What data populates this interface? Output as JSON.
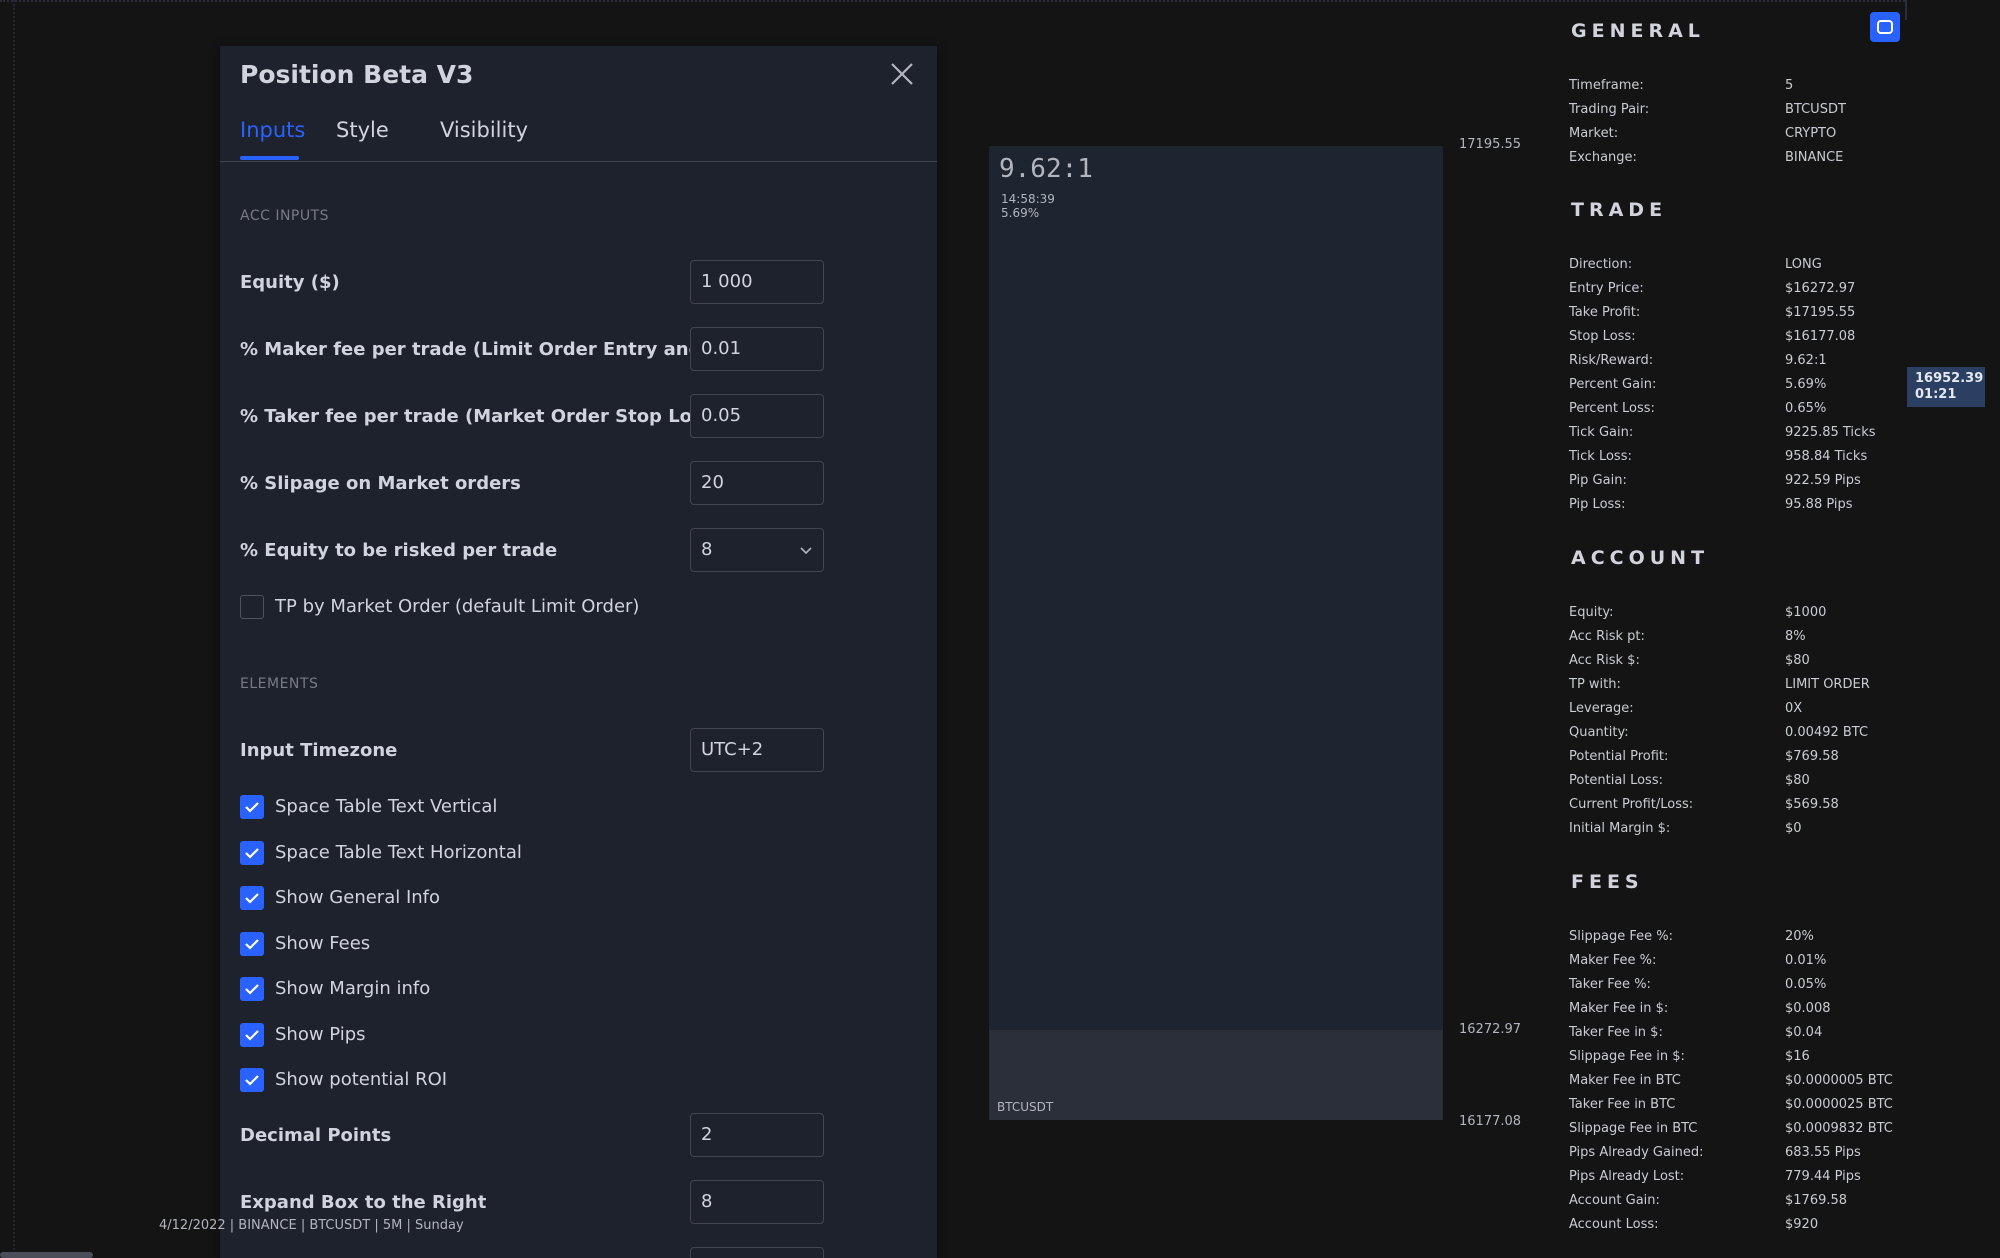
{
  "dialog": {
    "title": "Position Beta V3",
    "tabs": [
      {
        "label": "Inputs",
        "active": true
      },
      {
        "label": "Style",
        "active": false
      },
      {
        "label": "Visibility",
        "active": false
      }
    ],
    "sections": {
      "acc_inputs": "ACC INPUTS",
      "elements": "ELEMENTS"
    },
    "inputs": {
      "equity": {
        "label": "Equity ($)",
        "value": "1 000"
      },
      "maker_fee": {
        "label": "% Maker fee per trade (Limit Order Entry and Exit)",
        "value": "0.01"
      },
      "taker_fee": {
        "label": "% Taker fee per trade (Market Order Stop Loss)",
        "value": "0.05"
      },
      "slippage": {
        "label": "% Slipage on Market orders",
        "value": "20"
      },
      "risk": {
        "label": "% Equity to be risked per trade",
        "value": "8"
      },
      "tp_market": {
        "label": "TP by Market Order (default Limit Order)",
        "checked": false
      },
      "timezone": {
        "label": "Input Timezone",
        "value": "UTC+2"
      },
      "decimal_points": {
        "label": "Decimal Points",
        "value": "2"
      },
      "expand_box": {
        "label": "Expand Box to the Right",
        "value": "8"
      }
    },
    "element_checks": [
      {
        "label": "Space Table Text Vertical",
        "checked": true
      },
      {
        "label": "Space Table Text Horizontal",
        "checked": true
      },
      {
        "label": "Show General Info",
        "checked": true
      },
      {
        "label": "Show Fees",
        "checked": true
      },
      {
        "label": "Show Margin info",
        "checked": true
      },
      {
        "label": "Show Pips",
        "checked": true
      },
      {
        "label": "Show potential ROI",
        "checked": true
      }
    ]
  },
  "status_bar": "4/12/2022 | BINANCE | BTCUSDT | 5M | Sunday",
  "chart": {
    "ratio": "9.62:1",
    "time": "14:58:39",
    "percent": "5.69%",
    "symbol": "BTCUSDT",
    "prices": {
      "take_profit": "17195.55",
      "entry": "16272.97",
      "stop": "16177.08"
    },
    "price_tag": {
      "price": "16952.39",
      "countdown": "01:21"
    }
  },
  "info": {
    "general": {
      "title": "GENERAL",
      "rows": [
        {
          "k": "Timeframe:",
          "v": "5"
        },
        {
          "k": "Trading Pair:",
          "v": "BTCUSDT"
        },
        {
          "k": "Market:",
          "v": "CRYPTO"
        },
        {
          "k": "Exchange:",
          "v": "BINANCE"
        }
      ]
    },
    "trade": {
      "title": "TRADE",
      "rows": [
        {
          "k": "Direction:",
          "v": "LONG"
        },
        {
          "k": "Entry Price:",
          "v": "$16272.97"
        },
        {
          "k": "Take Profit:",
          "v": "$17195.55"
        },
        {
          "k": "Stop Loss:",
          "v": "$16177.08"
        },
        {
          "k": "Risk/Reward:",
          "v": "9.62:1"
        },
        {
          "k": "Percent Gain:",
          "v": "5.69%"
        },
        {
          "k": "Percent Loss:",
          "v": "0.65%"
        },
        {
          "k": "Tick Gain:",
          "v": "9225.85 Ticks"
        },
        {
          "k": "Tick Loss:",
          "v": "958.84 Ticks"
        },
        {
          "k": "Pip Gain:",
          "v": "922.59 Pips"
        },
        {
          "k": "Pip Loss:",
          "v": "95.88 Pips"
        }
      ]
    },
    "account": {
      "title": "ACCOUNT",
      "rows": [
        {
          "k": "Equity:",
          "v": "$1000"
        },
        {
          "k": "Acc Risk pt:",
          "v": "8%"
        },
        {
          "k": "Acc Risk $:",
          "v": "$80"
        },
        {
          "k": "TP with:",
          "v": "LIMIT ORDER"
        },
        {
          "k": "Leverage:",
          "v": "0X"
        },
        {
          "k": "Quantity:",
          "v": "0.00492 BTC"
        },
        {
          "k": "Potential Profit:",
          "v": "$769.58"
        },
        {
          "k": "Potential Loss:",
          "v": "$80"
        },
        {
          "k": "Current Profit/Loss:",
          "v": "$569.58"
        },
        {
          "k": "Initial Margin $:",
          "v": "$0"
        }
      ]
    },
    "fees": {
      "title": "FEES",
      "rows": [
        {
          "k": "Slippage Fee %:",
          "v": "20%"
        },
        {
          "k": "Maker Fee %:",
          "v": "0.01%"
        },
        {
          "k": "Taker Fee %:",
          "v": "0.05%"
        },
        {
          "k": "Maker Fee in $:",
          "v": "$0.008"
        },
        {
          "k": "Taker Fee in $:",
          "v": "$0.04"
        },
        {
          "k": "Slippage Fee in $:",
          "v": "$16"
        },
        {
          "k": "Maker Fee in BTC",
          "v": "$0.0000005 BTC"
        },
        {
          "k": "Taker Fee in BTC",
          "v": "$0.0000025 BTC"
        },
        {
          "k": "Slippage Fee in BTC",
          "v": "$0.0009832 BTC"
        },
        {
          "k": "Pips Already Gained:",
          "v": "683.55 Pips"
        },
        {
          "k": "Pips Already Lost:",
          "v": "779.44 Pips"
        },
        {
          "k": "Account Gain:",
          "v": "$1769.58"
        },
        {
          "k": "Account Loss:",
          "v": "$920"
        }
      ]
    }
  },
  "colors": {
    "accent": "#2962ff",
    "panel": "#1e222d",
    "background": "#141414"
  }
}
